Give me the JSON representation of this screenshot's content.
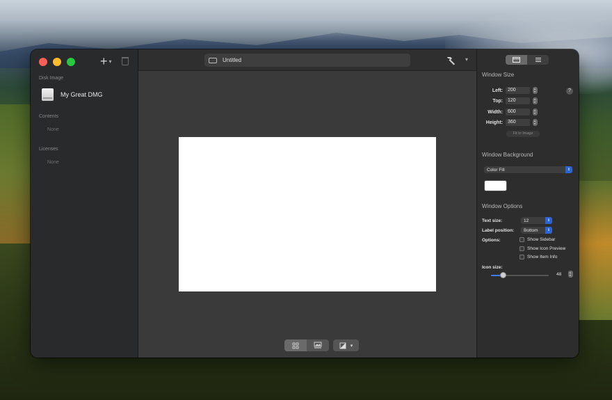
{
  "window": {
    "title": "Untitled"
  },
  "sidebar": {
    "sections": [
      {
        "title": "Disk Image",
        "items": [
          "My Great DMG"
        ]
      },
      {
        "title": "Contents",
        "empty_label": "None"
      },
      {
        "title": "Licenses",
        "empty_label": "None"
      }
    ],
    "icons": {
      "add": "plus-icon",
      "remove": "trash-icon"
    }
  },
  "toolbar": {
    "build_icon": "hammer-icon"
  },
  "inspector": {
    "window_size": {
      "title": "Window Size",
      "left_label": "Left:",
      "left_value": "200",
      "top_label": "Top:",
      "top_value": "120",
      "width_label": "Width:",
      "width_value": "600",
      "height_label": "Height:",
      "height_value": "360",
      "fit_button": "Fit to Image"
    },
    "window_background": {
      "title": "Window Background",
      "fill_type": "Color Fill",
      "color": "#ffffff"
    },
    "window_options": {
      "title": "Window Options",
      "text_size_label": "Text size:",
      "text_size_value": "12",
      "label_position_label": "Label position:",
      "label_position_value": "Bottom",
      "options_label": "Options:",
      "options": [
        {
          "label": "Show Sidebar",
          "checked": false
        },
        {
          "label": "Show Icon Preview",
          "checked": false
        },
        {
          "label": "Show Item Info",
          "checked": false
        }
      ],
      "icon_size_label": "Icon size:",
      "icon_size_value": "48",
      "icon_size_fraction": 0.2
    }
  },
  "accent": "#2d64d4"
}
